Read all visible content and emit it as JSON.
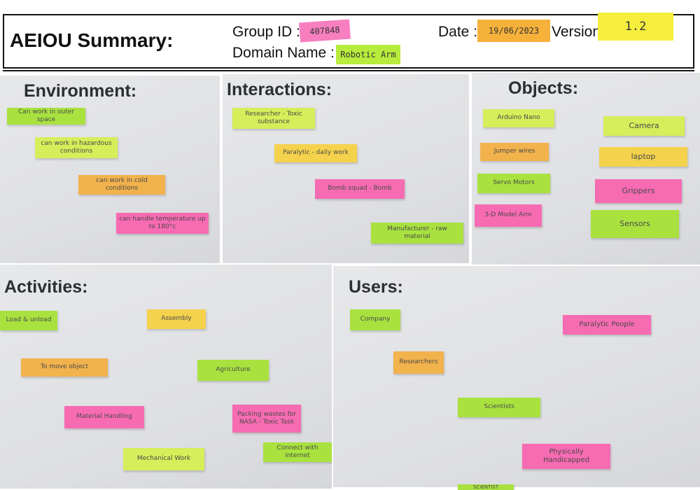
{
  "header": {
    "title": "AEIOU Summary:",
    "group_id_label": "Group ID :",
    "group_id_value": "407848",
    "domain_label": "Domain Name :",
    "domain_value": "Robotic Arm",
    "date_label": "Date :",
    "date_value": "19/06/2023",
    "version_label": "Version",
    "version_value": "1.2"
  },
  "environment": {
    "title": "Environment:",
    "notes": [
      "Can work in outer space",
      "can work in hazardous conditions",
      "can work in cold conditions",
      "can handle temperature up to 180°c"
    ]
  },
  "interactions": {
    "title": "Interactions:",
    "notes": [
      "Researcher - Toxic substance",
      "Paralytic - daily work",
      "Bomb squad - Bomb",
      "Manufacturer - raw material"
    ]
  },
  "objects": {
    "title": "Objects:",
    "notes": [
      "Arduino Nano",
      "Jumper wires",
      "Servo Motors",
      "3-D Model Arm",
      "Camera",
      "laptop",
      "Grippers",
      "Sensors"
    ]
  },
  "activities": {
    "title": "Activities:",
    "notes": [
      "Load & unload",
      "Assembly",
      "To move object",
      "Agriculture",
      "Material Handling",
      "Packing wastes for NASA - Toxic Task",
      "Mechanical Work",
      "Connect with internet"
    ]
  },
  "users": {
    "title": "Users:",
    "notes": [
      "Company",
      "Paralytic People",
      "Researchers",
      "Scientists",
      "Physically Handicapped"
    ]
  },
  "footer": {
    "partial_note": "SCIENTIST"
  }
}
